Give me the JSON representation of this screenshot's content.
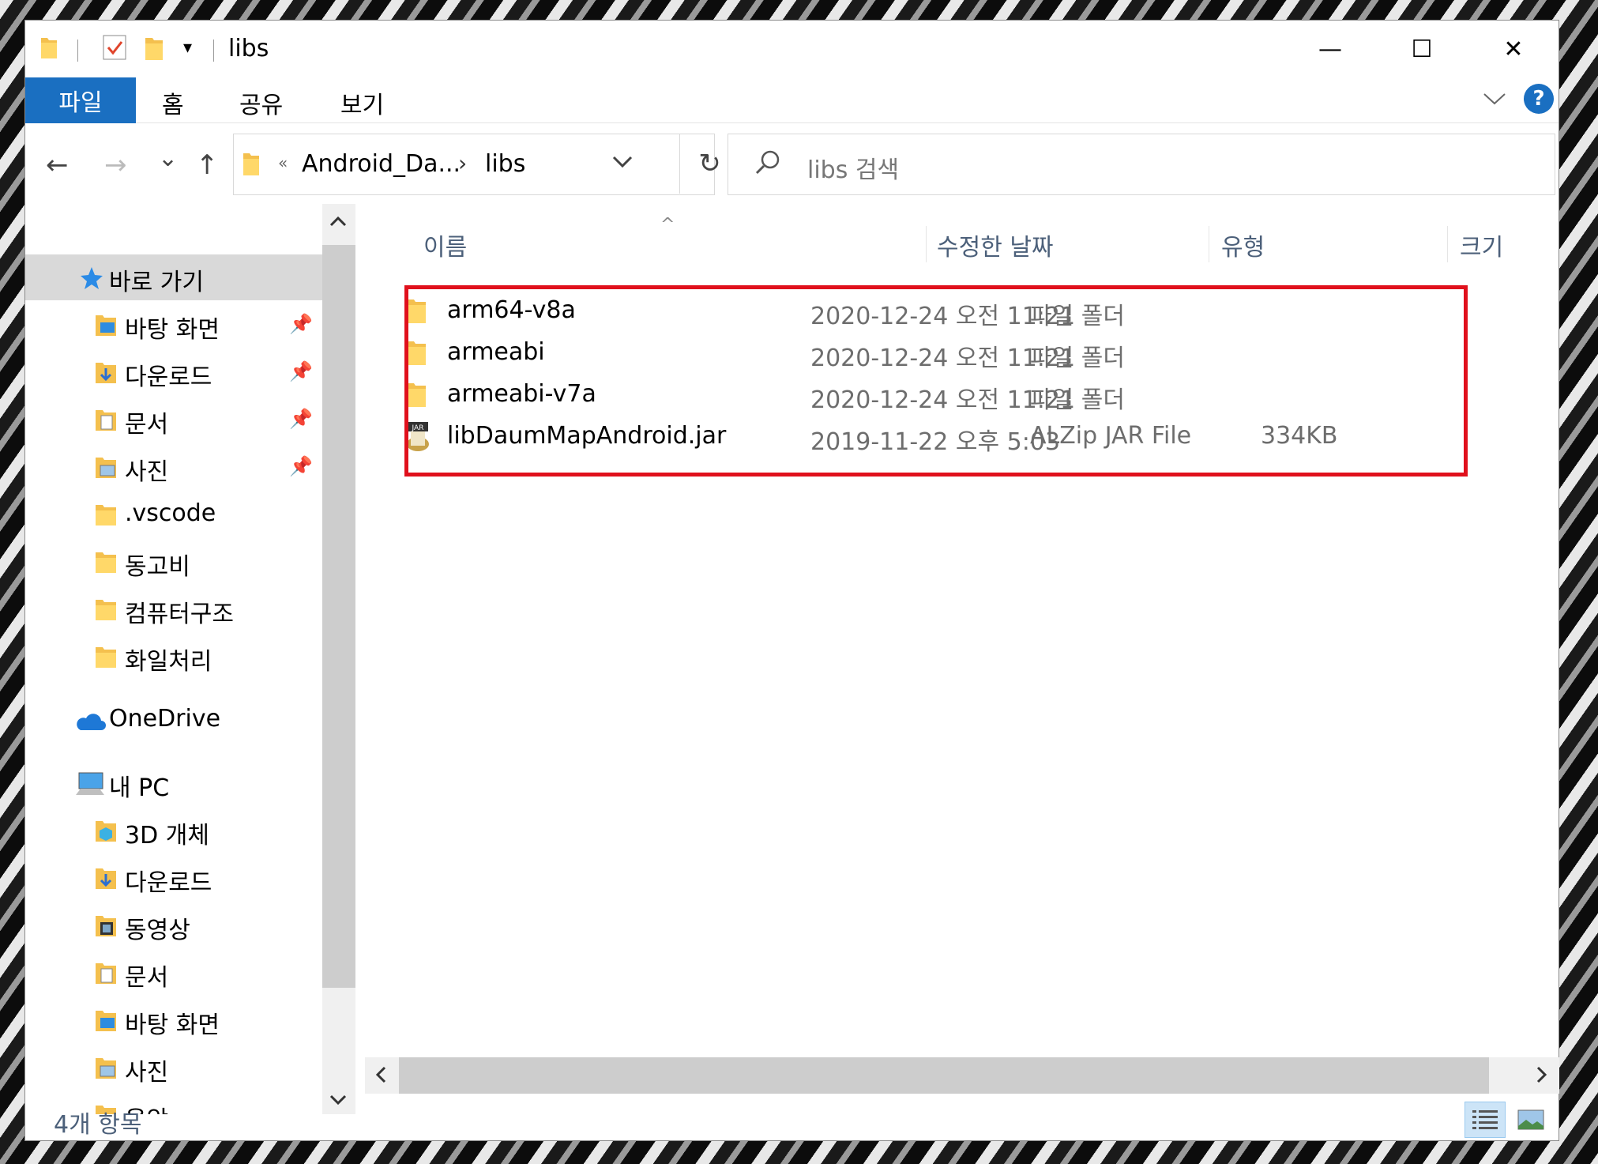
{
  "window": {
    "title": "libs",
    "controls": {
      "minimize": "—",
      "maximize": "☐",
      "close": "✕"
    }
  },
  "ribbon": {
    "tabs": [
      "파일",
      "홈",
      "공유",
      "보기"
    ],
    "expand_icon": "chevron-down-icon",
    "help_label": "?"
  },
  "navigation": {
    "back": "←",
    "forward": "→",
    "recent": "⌄",
    "up": "↑",
    "breadcrumb_overflow": "«",
    "breadcrumb": [
      "Android_Da...",
      "libs"
    ],
    "breadcrumb_separator": "›",
    "refresh": "↻",
    "search_placeholder": "libs 검색"
  },
  "sidebar": {
    "items": [
      {
        "label": "바로 가기",
        "icon": "star-icon",
        "selected": true
      },
      {
        "label": "바탕 화면",
        "icon": "desktop-folder-icon",
        "pinned": true
      },
      {
        "label": "다운로드",
        "icon": "downloads-folder-icon",
        "pinned": true
      },
      {
        "label": "문서",
        "icon": "documents-folder-icon",
        "pinned": true
      },
      {
        "label": "사진",
        "icon": "pictures-folder-icon",
        "pinned": true
      },
      {
        "label": ".vscode",
        "icon": "folder-icon"
      },
      {
        "label": "동고비",
        "icon": "folder-icon"
      },
      {
        "label": "컴퓨터구조",
        "icon": "folder-icon"
      },
      {
        "label": "화일처리",
        "icon": "folder-icon"
      },
      {
        "label": "OneDrive",
        "icon": "cloud-icon"
      },
      {
        "label": "내 PC",
        "icon": "computer-icon"
      },
      {
        "label": "3D 개체",
        "icon": "3d-objects-folder-icon"
      },
      {
        "label": "다운로드",
        "icon": "downloads-folder-icon"
      },
      {
        "label": "동영상",
        "icon": "videos-folder-icon"
      },
      {
        "label": "문서",
        "icon": "documents-folder-icon"
      },
      {
        "label": "바탕 화면",
        "icon": "desktop-folder-icon"
      },
      {
        "label": "사진",
        "icon": "pictures-folder-icon"
      },
      {
        "label": "음악",
        "icon": "music-folder-icon"
      }
    ],
    "pin_glyph": "📌"
  },
  "columns": {
    "name": "이름",
    "date": "수정한 날짜",
    "type": "유형",
    "size": "크기"
  },
  "files": [
    {
      "name": "arm64-v8a",
      "date": "2020-12-24 오전 11:21",
      "type": "파일 폴더",
      "size": "",
      "icon": "folder-icon"
    },
    {
      "name": "armeabi",
      "date": "2020-12-24 오전 11:21",
      "type": "파일 폴더",
      "size": "",
      "icon": "folder-icon"
    },
    {
      "name": "armeabi-v7a",
      "date": "2020-12-24 오전 11:21",
      "type": "파일 폴더",
      "size": "",
      "icon": "folder-icon"
    },
    {
      "name": "libDaumMapAndroid.jar",
      "date": "2019-11-22 오후 5:03",
      "type": "ALZip JAR File",
      "size": "334KB",
      "icon": "jar-file-icon"
    }
  ],
  "status": {
    "item_count": "4개 항목"
  },
  "colors": {
    "accent": "#1a6fc1",
    "highlight": "#e0101c",
    "header_text": "#4c607a"
  }
}
